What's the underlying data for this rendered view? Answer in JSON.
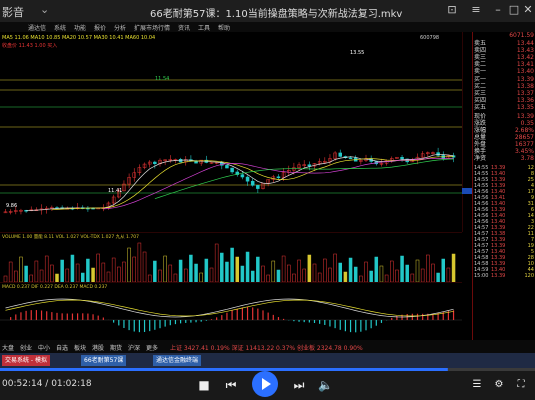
{
  "window": {
    "app_name": "影音",
    "title": "66老耐第57课：1.10当前操盘策略与次新战法复习.mkv"
  },
  "stock_app": {
    "menu_items": [
      "通达信",
      "系统",
      "功能",
      "报价",
      "分析",
      "扩展市场行情",
      "资讯",
      "工具",
      "帮助"
    ],
    "indicator_labels": {
      "ma_line": "MA5 11.06  MA10 10.85  MA20 10.57  MA30 10.41  MA60 10.04",
      "main_line2": "收盘价 11.43  1.00  买入",
      "vol_label": "VOLUME 1.00  量能  8.11  VOL 1.027  VOL-TDX 1.027  九从 1.707",
      "macd_label": "MACD 0.237  DIF 0.227  DEA 0.237  MACD 0.237",
      "stock_code": "600798"
    },
    "chart_annotations": {
      "price_high": "13.55",
      "price_mid": "11.39",
      "price_low": "9.86",
      "marker_a": "11.41",
      "marker_b": "11.54",
      "vol_scale": "16.08"
    },
    "right_panel": {
      "header": "6071.59",
      "sell_labels": [
        "卖五",
        "卖四",
        "卖三",
        "卖二",
        "卖一"
      ],
      "sell_prices": [
        "13.44",
        "13.43",
        "13.42",
        "13.41",
        "13.40"
      ],
      "buy_labels": [
        "买一",
        "买二",
        "买三",
        "买四",
        "买五"
      ],
      "buy_prices": [
        "13.39",
        "13.38",
        "13.37",
        "13.36",
        "13.35"
      ],
      "stats": [
        {
          "label": "现价",
          "value": "13.39"
        },
        {
          "label": "涨跌",
          "value": "0.35"
        },
        {
          "label": "涨幅",
          "value": "2.68%"
        },
        {
          "label": "总量",
          "value": "28657"
        },
        {
          "label": "外盘",
          "value": "16377"
        },
        {
          "label": "换手",
          "value": "3.45%"
        },
        {
          "label": "净资",
          "value": "3.78"
        }
      ],
      "tick_rows": [
        {
          "time": "14:55",
          "price": "13.39",
          "vol": "12"
        },
        {
          "time": "14:55",
          "price": "13.40",
          "vol": "8"
        },
        {
          "time": "14:55",
          "price": "13.39",
          "vol": "25"
        },
        {
          "time": "14:55",
          "price": "13.39",
          "vol": "4"
        },
        {
          "time": "14:56",
          "price": "13.40",
          "vol": "17"
        },
        {
          "time": "14:56",
          "price": "13.41",
          "vol": "9"
        },
        {
          "time": "14:56",
          "price": "13.40",
          "vol": "31"
        },
        {
          "time": "14:56",
          "price": "13.39",
          "vol": "6"
        },
        {
          "time": "14:56",
          "price": "13.40",
          "vol": "14"
        },
        {
          "time": "14:56",
          "price": "13.40",
          "vol": "3"
        },
        {
          "time": "14:57",
          "price": "13.39",
          "vol": "22"
        },
        {
          "time": "14:57",
          "price": "13.38",
          "vol": "11"
        },
        {
          "time": "14:57",
          "price": "13.39",
          "vol": "7"
        },
        {
          "time": "14:57",
          "price": "13.39",
          "vol": "19"
        },
        {
          "time": "14:57",
          "price": "13.40",
          "vol": "5"
        },
        {
          "time": "14:58",
          "price": "13.39",
          "vol": "28"
        },
        {
          "time": "14:58",
          "price": "13.39",
          "vol": "10"
        },
        {
          "time": "14:59",
          "price": "13.40",
          "vol": "44"
        },
        {
          "time": "15:00",
          "price": "13.39",
          "vol": "120"
        }
      ]
    },
    "bottom_tabs": [
      "大盘",
      "创业",
      "中小",
      "自选",
      "板块",
      "港股",
      "期货",
      "沪深",
      "更多"
    ],
    "bottom_status": "上证 3427.41  0.19%  深证 11413.22  0.37%  创业板 2324.78  0.90%"
  },
  "taskbar": {
    "items": [
      "交易系统 - 模拟",
      "66老耐第57课",
      "通达信金融终端"
    ]
  },
  "player": {
    "current_time": "00:52:14",
    "total_time": "01:02:18",
    "progress": 0.837,
    "separator": " / "
  },
  "colors": {
    "up": "#e63434",
    "down": "#22c8c8",
    "ma_yellow": "#e8e030",
    "ma_green": "#30d050",
    "ma_white": "#e0e0e0",
    "ma_magenta": "#d040d0",
    "accent_player": "#2b6fff"
  }
}
